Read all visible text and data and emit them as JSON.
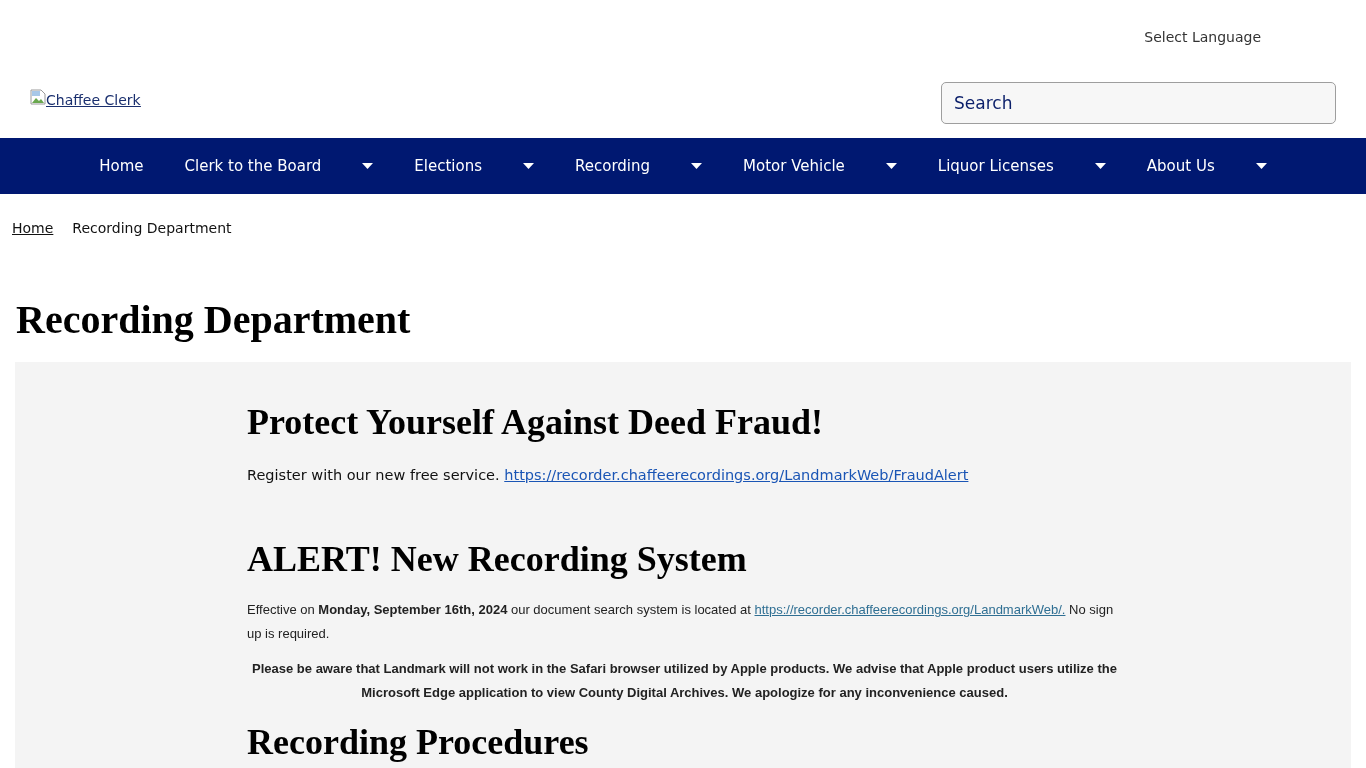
{
  "header": {
    "language_selector": "Select Language",
    "logo": {
      "alt_text": "Chaffee Clerk"
    },
    "search": {
      "placeholder": "Search"
    }
  },
  "nav": {
    "items": [
      {
        "label": "Home",
        "dropdown": false
      },
      {
        "label": "Clerk to the Board",
        "dropdown": true
      },
      {
        "label": "Elections",
        "dropdown": true
      },
      {
        "label": "Recording",
        "dropdown": true
      },
      {
        "label": "Motor Vehicle",
        "dropdown": true
      },
      {
        "label": "Liquor Licenses",
        "dropdown": true
      },
      {
        "label": "About Us",
        "dropdown": true
      }
    ]
  },
  "breadcrumb": [
    {
      "label": "Home",
      "kind": "link"
    },
    {
      "label": "Recording Department",
      "kind": "current"
    }
  ],
  "page_title": "Recording Department",
  "sections": [
    {
      "heading": "Protect Yourself Against Deed Fraud!",
      "paragraphs": [
        {
          "kind": "intro",
          "text_before": "Register with our new free service.",
          "link": "https://recorder.chaffeerecordings.org/LandmarkWeb/FraudAlert"
        }
      ]
    },
    {
      "heading": "ALERT! New Recording System",
      "paragraphs": [
        {
          "kind": "note",
          "text_before": "Effective on **Monday, September 16th, 2024** our document search system is located at",
          "link": "https://recorder.chaffeerecordings.org/LandmarkWeb/.",
          "text_after": "No sign up is required."
        },
        {
          "kind": "notice",
          "text_before": "Please be aware that Landmark will not work in the Safari browser utilized by Apple products. We advise that Apple product users utilize the Microsoft Edge application to view County Digital Archives. We apologize for any inconvenience caused."
        }
      ]
    },
    {
      "heading": "Recording Procedures"
    }
  ]
}
